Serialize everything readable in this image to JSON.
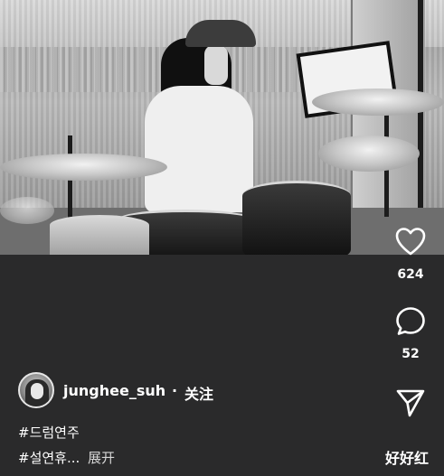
{
  "video": {
    "icons": [
      "drum-kit-scene"
    ]
  },
  "actions": {
    "like": {
      "icon": "heart-icon",
      "count": "624"
    },
    "comment": {
      "icon": "comment-bubble-icon",
      "count": "52"
    },
    "share": {
      "icon": "send-arrow-icon"
    }
  },
  "author": {
    "username": "junghee_suh",
    "separator": "·",
    "follow_label": "关注"
  },
  "caption": {
    "hashtag_1": "#드럼연주",
    "hashtag_2": "#설연휴...",
    "expand_label": "展开"
  },
  "watermark": "好好红",
  "colors": {
    "background": "#2a2a2b",
    "text": "#ffffff",
    "secondary_text": "#d6d6d6"
  }
}
